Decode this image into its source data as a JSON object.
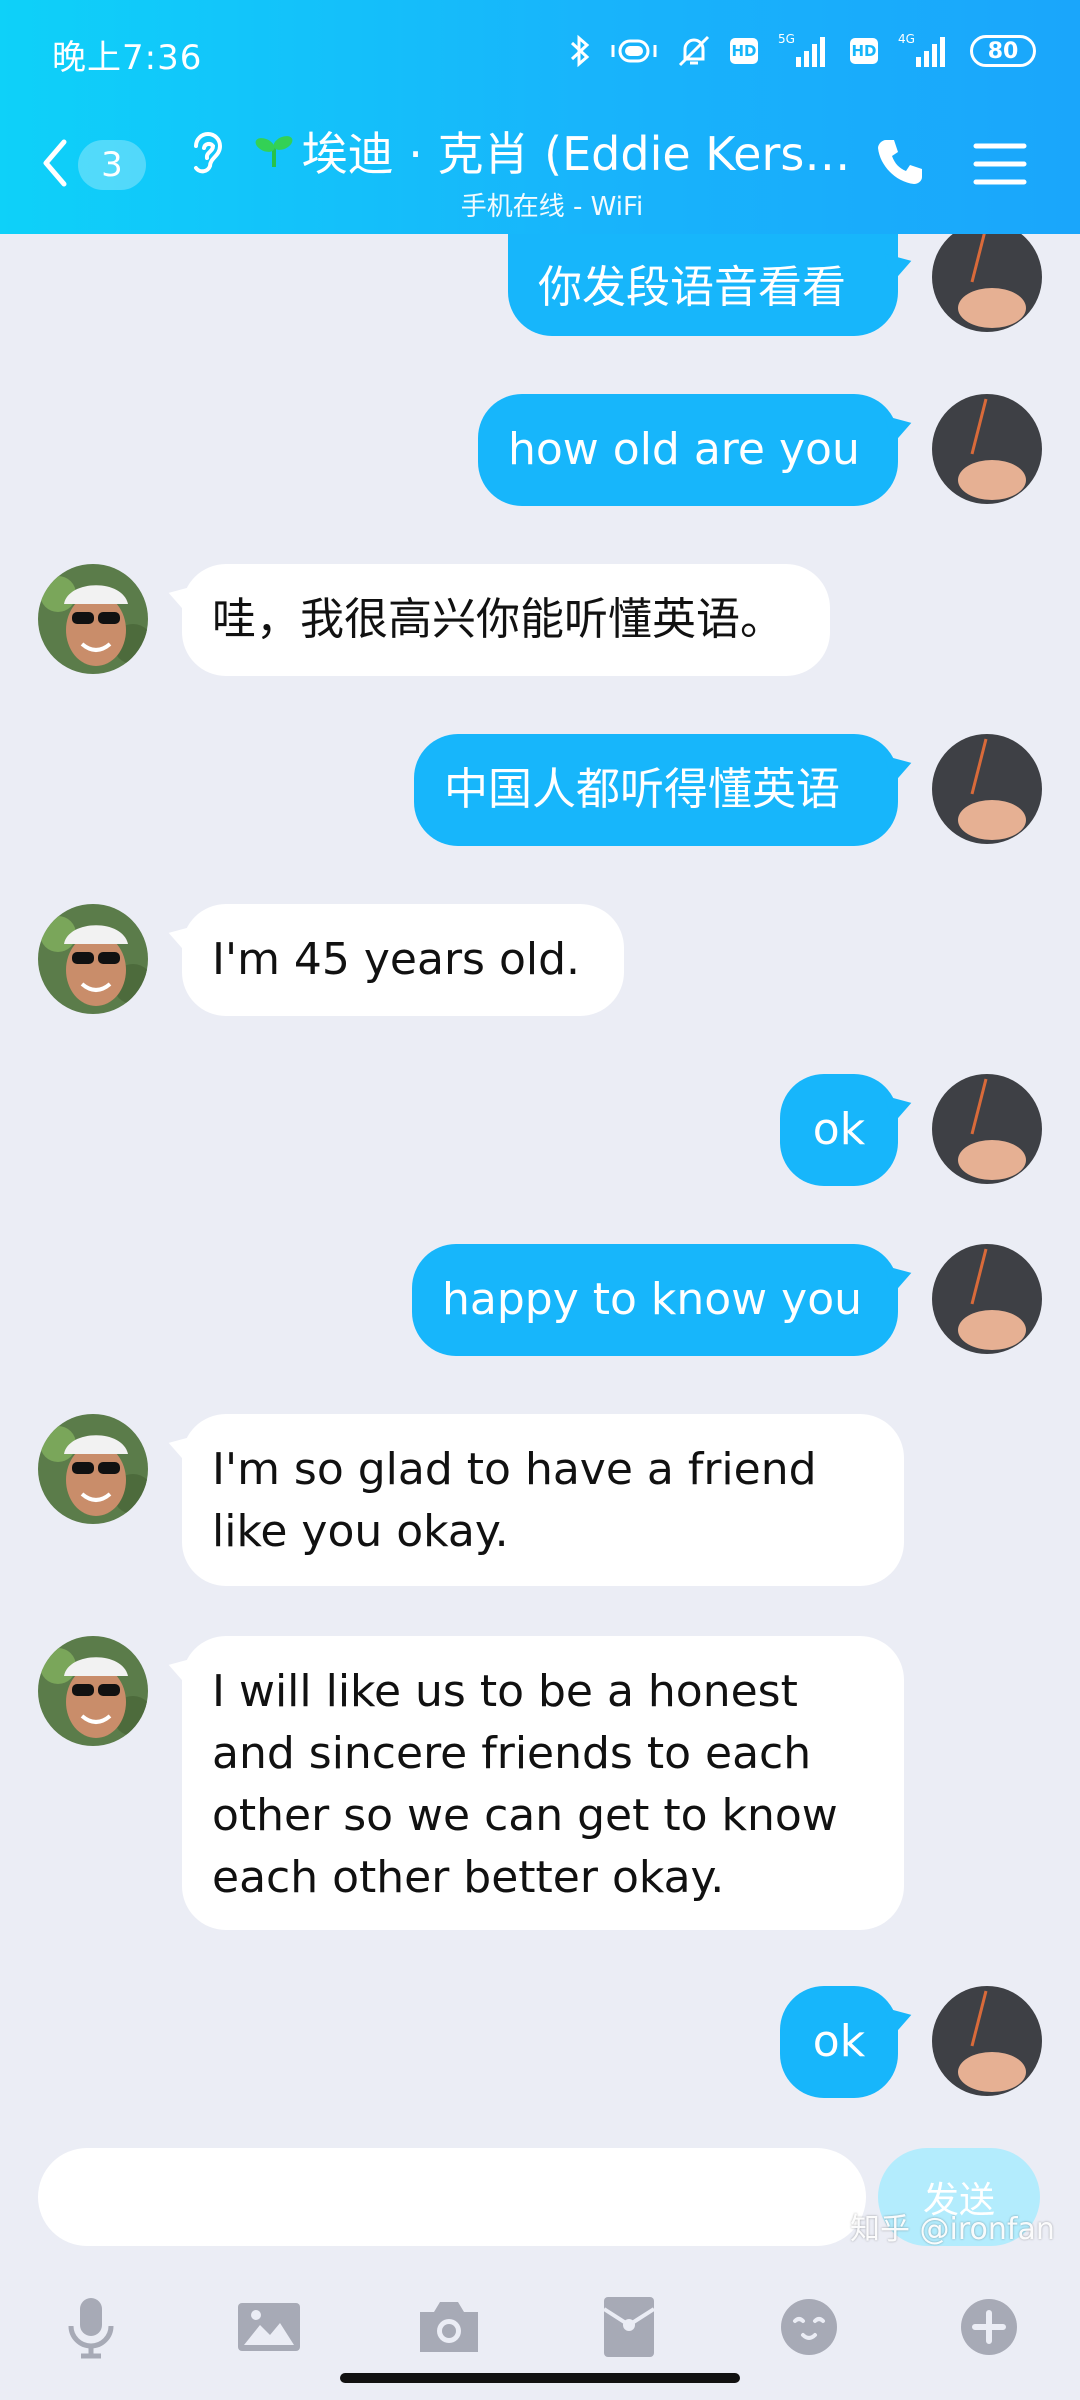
{
  "status_bar": {
    "time": "晚上7:36",
    "battery": "80",
    "net_5g": "5G",
    "net_4g": "4G",
    "hd": "HD"
  },
  "nav": {
    "unread_count": "3",
    "title": "埃迪 · 克肖 (Eddie Kers…",
    "subtitle": "手机在线 - WiFi"
  },
  "messages": [
    {
      "from": "me",
      "text": "你发段语音看看"
    },
    {
      "from": "me",
      "text": "how old are you"
    },
    {
      "from": "them",
      "text": "哇，我很高兴你能听懂英语。"
    },
    {
      "from": "me",
      "text": "中国人都听得懂英语"
    },
    {
      "from": "them",
      "text": "I'm 45 years old."
    },
    {
      "from": "me",
      "text": "ok"
    },
    {
      "from": "me",
      "text": "happy to know you"
    },
    {
      "from": "them",
      "text": "I'm so glad to have a friend like you okay."
    },
    {
      "from": "them",
      "text": "I will like us to be a honest and sincere friends to each other so we can get to know each other better okay."
    },
    {
      "from": "me",
      "text": "ok"
    }
  ],
  "composer": {
    "input_value": "",
    "send_label": "发送"
  },
  "toolbar_icons": [
    "microphone-icon",
    "image-icon",
    "camera-icon",
    "red-packet-icon",
    "emoji-icon",
    "plus-icon"
  ],
  "watermark": "知乎 @ironfan",
  "colors": {
    "header_start": "#0ed1f9",
    "header_end": "#1aa6fb",
    "my_bubble": "#17b6fb",
    "their_bubble": "#ffffff",
    "background": "#ebedf5",
    "send_disabled": "#b3ecfd"
  }
}
